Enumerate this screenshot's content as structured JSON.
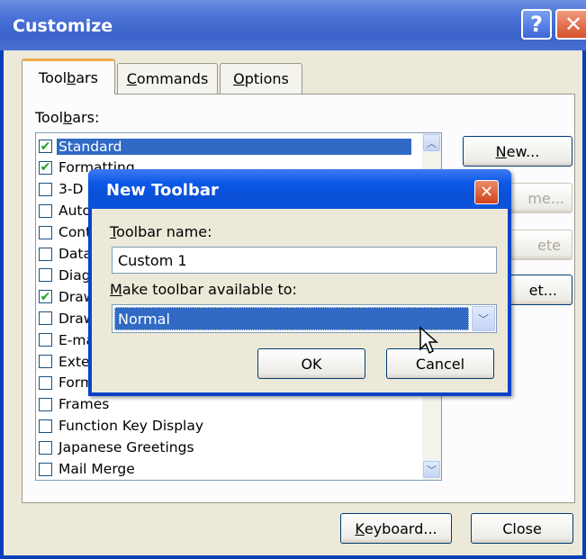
{
  "window": {
    "title": "Customize",
    "help_glyph": "?",
    "close_glyph": "✕"
  },
  "tabs": [
    {
      "label_pre": "Tool",
      "label_key": "b",
      "label_post": "ars"
    },
    {
      "label_pre": "",
      "label_key": "C",
      "label_post": "ommands"
    },
    {
      "label_pre": "",
      "label_key": "O",
      "label_post": "ptions"
    }
  ],
  "toolbars_label": {
    "pre": "Tool",
    "key": "b",
    "post": "ars:"
  },
  "toolbar_list": [
    {
      "label": "Standard",
      "checked": true
    },
    {
      "label": "Formatting",
      "checked": true
    },
    {
      "label": "3-D Settings",
      "checked": false
    },
    {
      "label": "AutoText",
      "checked": false
    },
    {
      "label": "Control Toolbox",
      "checked": false
    },
    {
      "label": "Database",
      "checked": false
    },
    {
      "label": "Diagram",
      "checked": false
    },
    {
      "label": "Drawing",
      "checked": true
    },
    {
      "label": "Drawing Canvas",
      "checked": false
    },
    {
      "label": "E-mail",
      "checked": false
    },
    {
      "label": "Extended Formatting",
      "checked": false
    },
    {
      "label": "Forms",
      "checked": false
    },
    {
      "label": "Frames",
      "checked": false
    },
    {
      "label": "Function Key Display",
      "checked": false
    },
    {
      "label": "Japanese Greetings",
      "checked": false
    },
    {
      "label": "Mail Merge",
      "checked": false
    }
  ],
  "side_buttons": {
    "new": {
      "key": "N",
      "post": "ew..."
    },
    "rename": "me...",
    "delete": "ete",
    "reset": "et..."
  },
  "bottom_buttons": {
    "keyboard": {
      "key": "K",
      "post": "eyboard..."
    },
    "close": "Close"
  },
  "dialog": {
    "title": "New Toolbar",
    "close_glyph": "✕",
    "name_label": {
      "key": "T",
      "post": "oolbar name:"
    },
    "name_value": "Custom 1",
    "avail_label": {
      "key": "M",
      "post": "ake toolbar available to:"
    },
    "avail_value": "Normal",
    "ok": "OK",
    "cancel": "Cancel"
  },
  "colors": {
    "selection": "#316ac5",
    "dialog_face": "#ece9d8",
    "check": "#21a121"
  }
}
